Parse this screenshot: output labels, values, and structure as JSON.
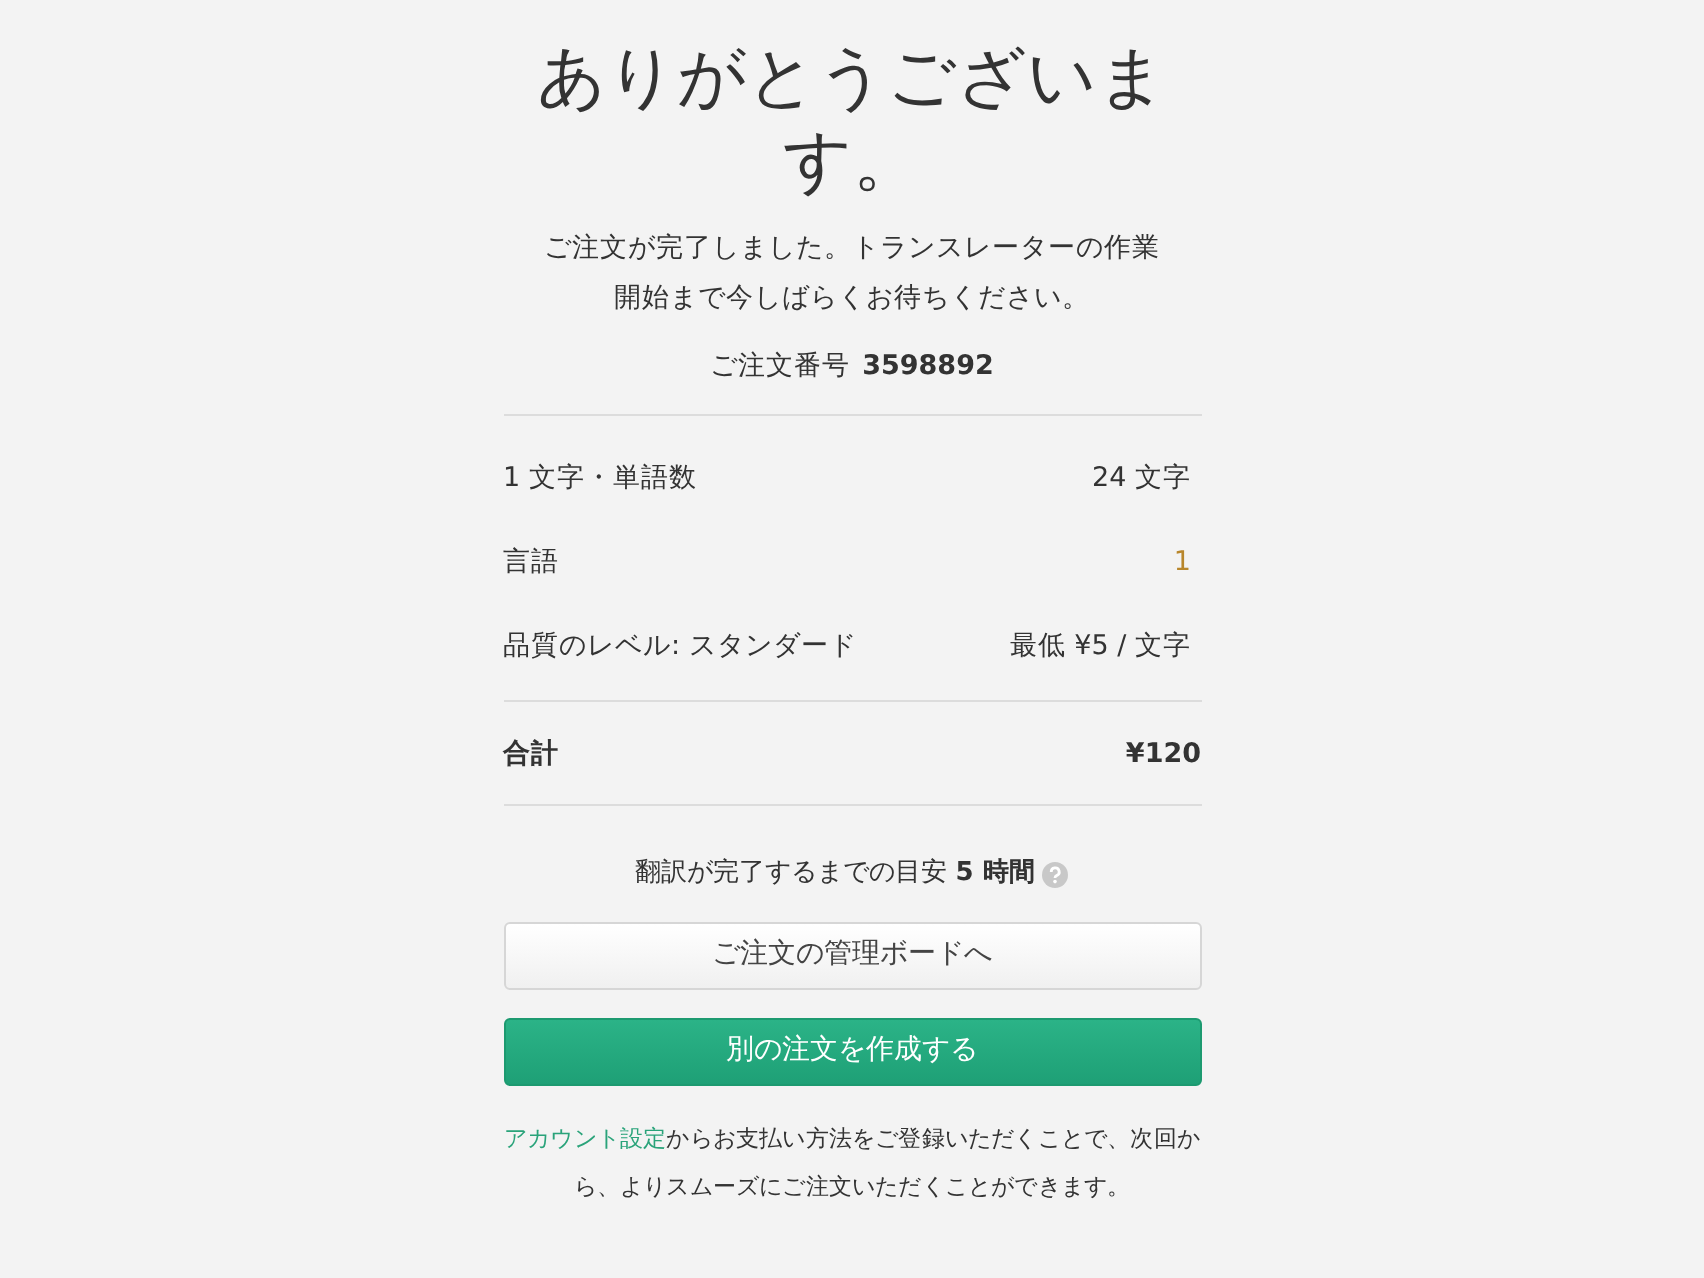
{
  "title": "ありがとうございます。",
  "message": "ご注文が完了しました。トランスレーターの作業開始まで今しばらくお待ちください。",
  "order_number": {
    "label": "ご注文番号",
    "value": "3598892"
  },
  "summary": [
    {
      "label": "1 文字・単語数",
      "value": "24 文字"
    },
    {
      "label": "言語",
      "value": "1"
    },
    {
      "label": "品質のレベル: スタンダード",
      "value": "最低 ¥5 / 文字"
    }
  ],
  "total": {
    "label": "合計",
    "value": "¥120"
  },
  "estimate": "翻訳が完了するまでの目安 **5 時間**",
  "buttons": [
    {
      "label": "ご注文の管理ボードへ",
      "kind": "secondary"
    },
    {
      "label": "別の注文を作成する",
      "kind": "primary"
    }
  ],
  "footer": {
    "link": "アカウント設定",
    "text": "からお支払い方法をご登録いただくことで、次回から、よりスムーズにご注文いただくことができます。"
  }
}
